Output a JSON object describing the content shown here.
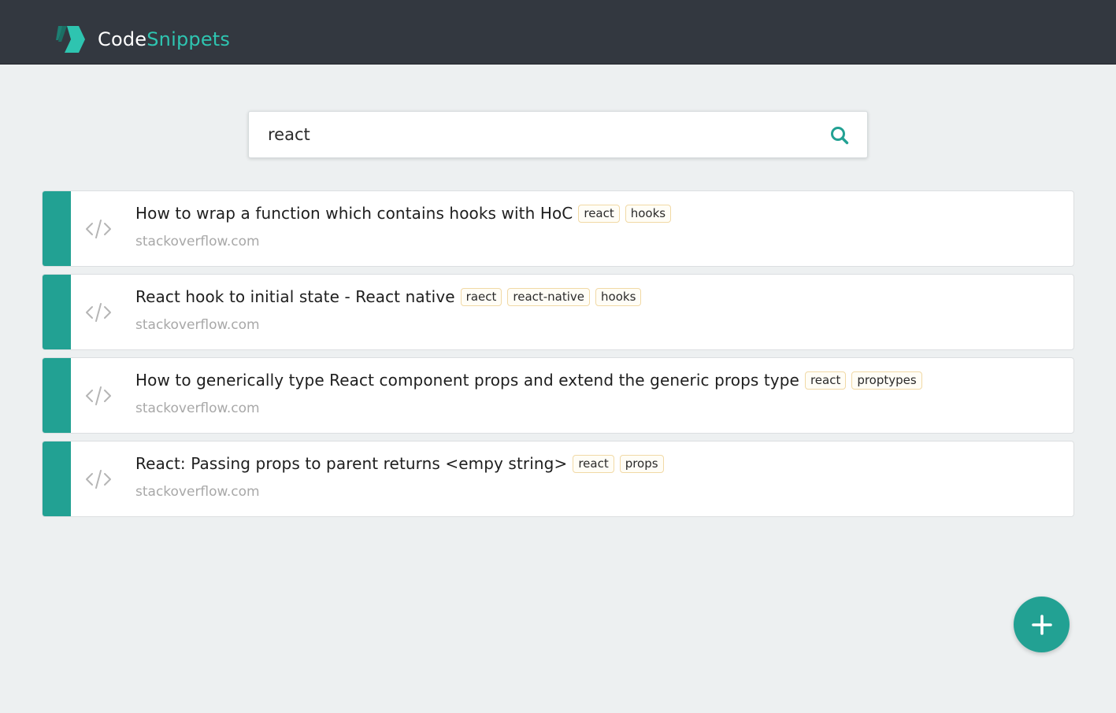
{
  "brand": {
    "name_part1": "Code",
    "name_part2": "Snippets",
    "accent_color": "#2ec4b0"
  },
  "search": {
    "value": "react",
    "icon": "search-icon"
  },
  "snippets": [
    {
      "title": "How to wrap a function which contains hooks with HoC",
      "tags": [
        "react",
        "hooks"
      ],
      "source": "stackoverflow.com",
      "icon": "code-icon"
    },
    {
      "title": "React hook to initial state - React native",
      "tags": [
        "raect",
        "react-native",
        "hooks"
      ],
      "source": "stackoverflow.com",
      "icon": "code-icon"
    },
    {
      "title": "How to generically type React component props and extend the generic props type",
      "tags": [
        "react",
        "proptypes"
      ],
      "source": "stackoverflow.com",
      "icon": "code-icon"
    },
    {
      "title": "React: Passing props to parent returns <empy string>",
      "tags": [
        "react",
        "props"
      ],
      "source": "stackoverflow.com",
      "icon": "code-icon"
    }
  ],
  "fab": {
    "icon": "plus-icon"
  },
  "colors": {
    "header_bg": "#333840",
    "page_bg": "#edf0f1",
    "stripe": "#22a193",
    "tag_border": "#f1d9a5",
    "source_text": "#a8a8a8"
  }
}
